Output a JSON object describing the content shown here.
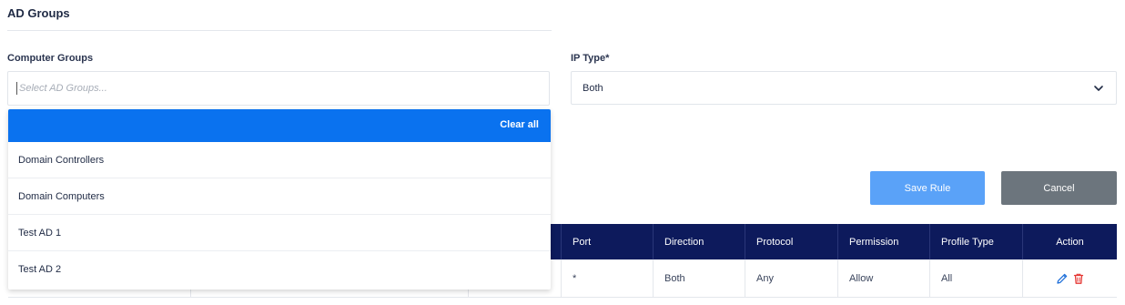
{
  "section": {
    "title": "AD Groups"
  },
  "computer_groups": {
    "label": "Computer Groups",
    "placeholder": "Select AD Groups...",
    "dropdown": {
      "clear_all": "Clear all",
      "options": [
        "Domain Controllers",
        "Domain Computers",
        "Test AD 1",
        "Test AD 2"
      ]
    }
  },
  "ip_type": {
    "label": "IP Type*",
    "value": "Both"
  },
  "buttons": {
    "save": "Save Rule",
    "cancel": "Cancel"
  },
  "table": {
    "headers": [
      "Port",
      "Direction",
      "Protocol",
      "Permission",
      "Profile Type",
      "Action"
    ],
    "rows": [
      {
        "port": "*",
        "direction": "Both",
        "protocol": "Any",
        "permission": "Allow",
        "profile_type": "All"
      }
    ]
  },
  "colors": {
    "primary": "#0a72ef",
    "save_button": "#5aa2f8",
    "cancel_button": "#6c757d",
    "table_header": "#0d1a5c",
    "delete_icon": "#e53935",
    "edit_icon": "#1e6fd9"
  },
  "icons": {
    "select_chevron": "chevron-down-icon",
    "edit": "pencil-icon",
    "delete": "trash-icon"
  }
}
